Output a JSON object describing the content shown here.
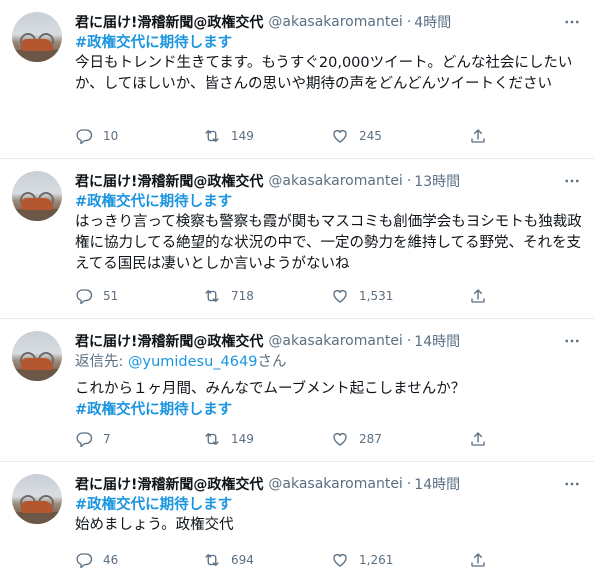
{
  "tweets": [
    {
      "name": "君に届け!滑稽新聞@政権交代",
      "handle": "@akasakaromantei",
      "dot": "·",
      "time": "4時間",
      "hashtag": "#政権交代に期待します",
      "text": "今日もトレンド生きてます。もうすぐ20,000ツイート。どんな社会にしたいか、してほしいか、皆さんの思いや期待の声をどんどんツイートください",
      "replies": "10",
      "retweets": "149",
      "likes": "245"
    },
    {
      "name": "君に届け!滑稽新聞@政権交代",
      "handle": "@akasakaromantei",
      "dot": "·",
      "time": "13時間",
      "hashtag": "#政権交代に期待します",
      "text": "はっきり言って検察も警察も霞が関もマスコミも創価学会もヨシモトも独裁政権に協力してる絶望的な状況の中で、一定の勢力を維持してる野党、それを支えてる国民は凄いとしか言いようがないね",
      "replies": "51",
      "retweets": "718",
      "likes": "1,531"
    },
    {
      "name": "君に届け!滑稽新聞@政権交代",
      "handle": "@akasakaromantei",
      "dot": "·",
      "time": "14時間",
      "reply_prefix": "返信先:",
      "reply_mention": "@yumidesu_4649",
      "reply_suffix": "さん",
      "text": "これから１ヶ月間、みんなでムーブメント起こしませんか？",
      "hashtag": "#政権交代に期待します",
      "replies": "7",
      "retweets": "149",
      "likes": "287"
    },
    {
      "name": "君に届け!滑稽新聞@政権交代",
      "handle": "@akasakaromantei",
      "dot": "·",
      "time": "14時間",
      "hashtag": "#政権交代に期待します",
      "text": "始めましょう。政権交代",
      "replies": "46",
      "retweets": "694",
      "likes": "1,261"
    }
  ],
  "icons": {
    "more": "more-horizontal-icon",
    "reply": "reply-icon",
    "retweet": "retweet-icon",
    "like": "heart-icon",
    "share": "share-icon"
  },
  "colors": {
    "link": "#1b95e0",
    "muted": "#5b7083",
    "divider": "#e6ecf0"
  }
}
